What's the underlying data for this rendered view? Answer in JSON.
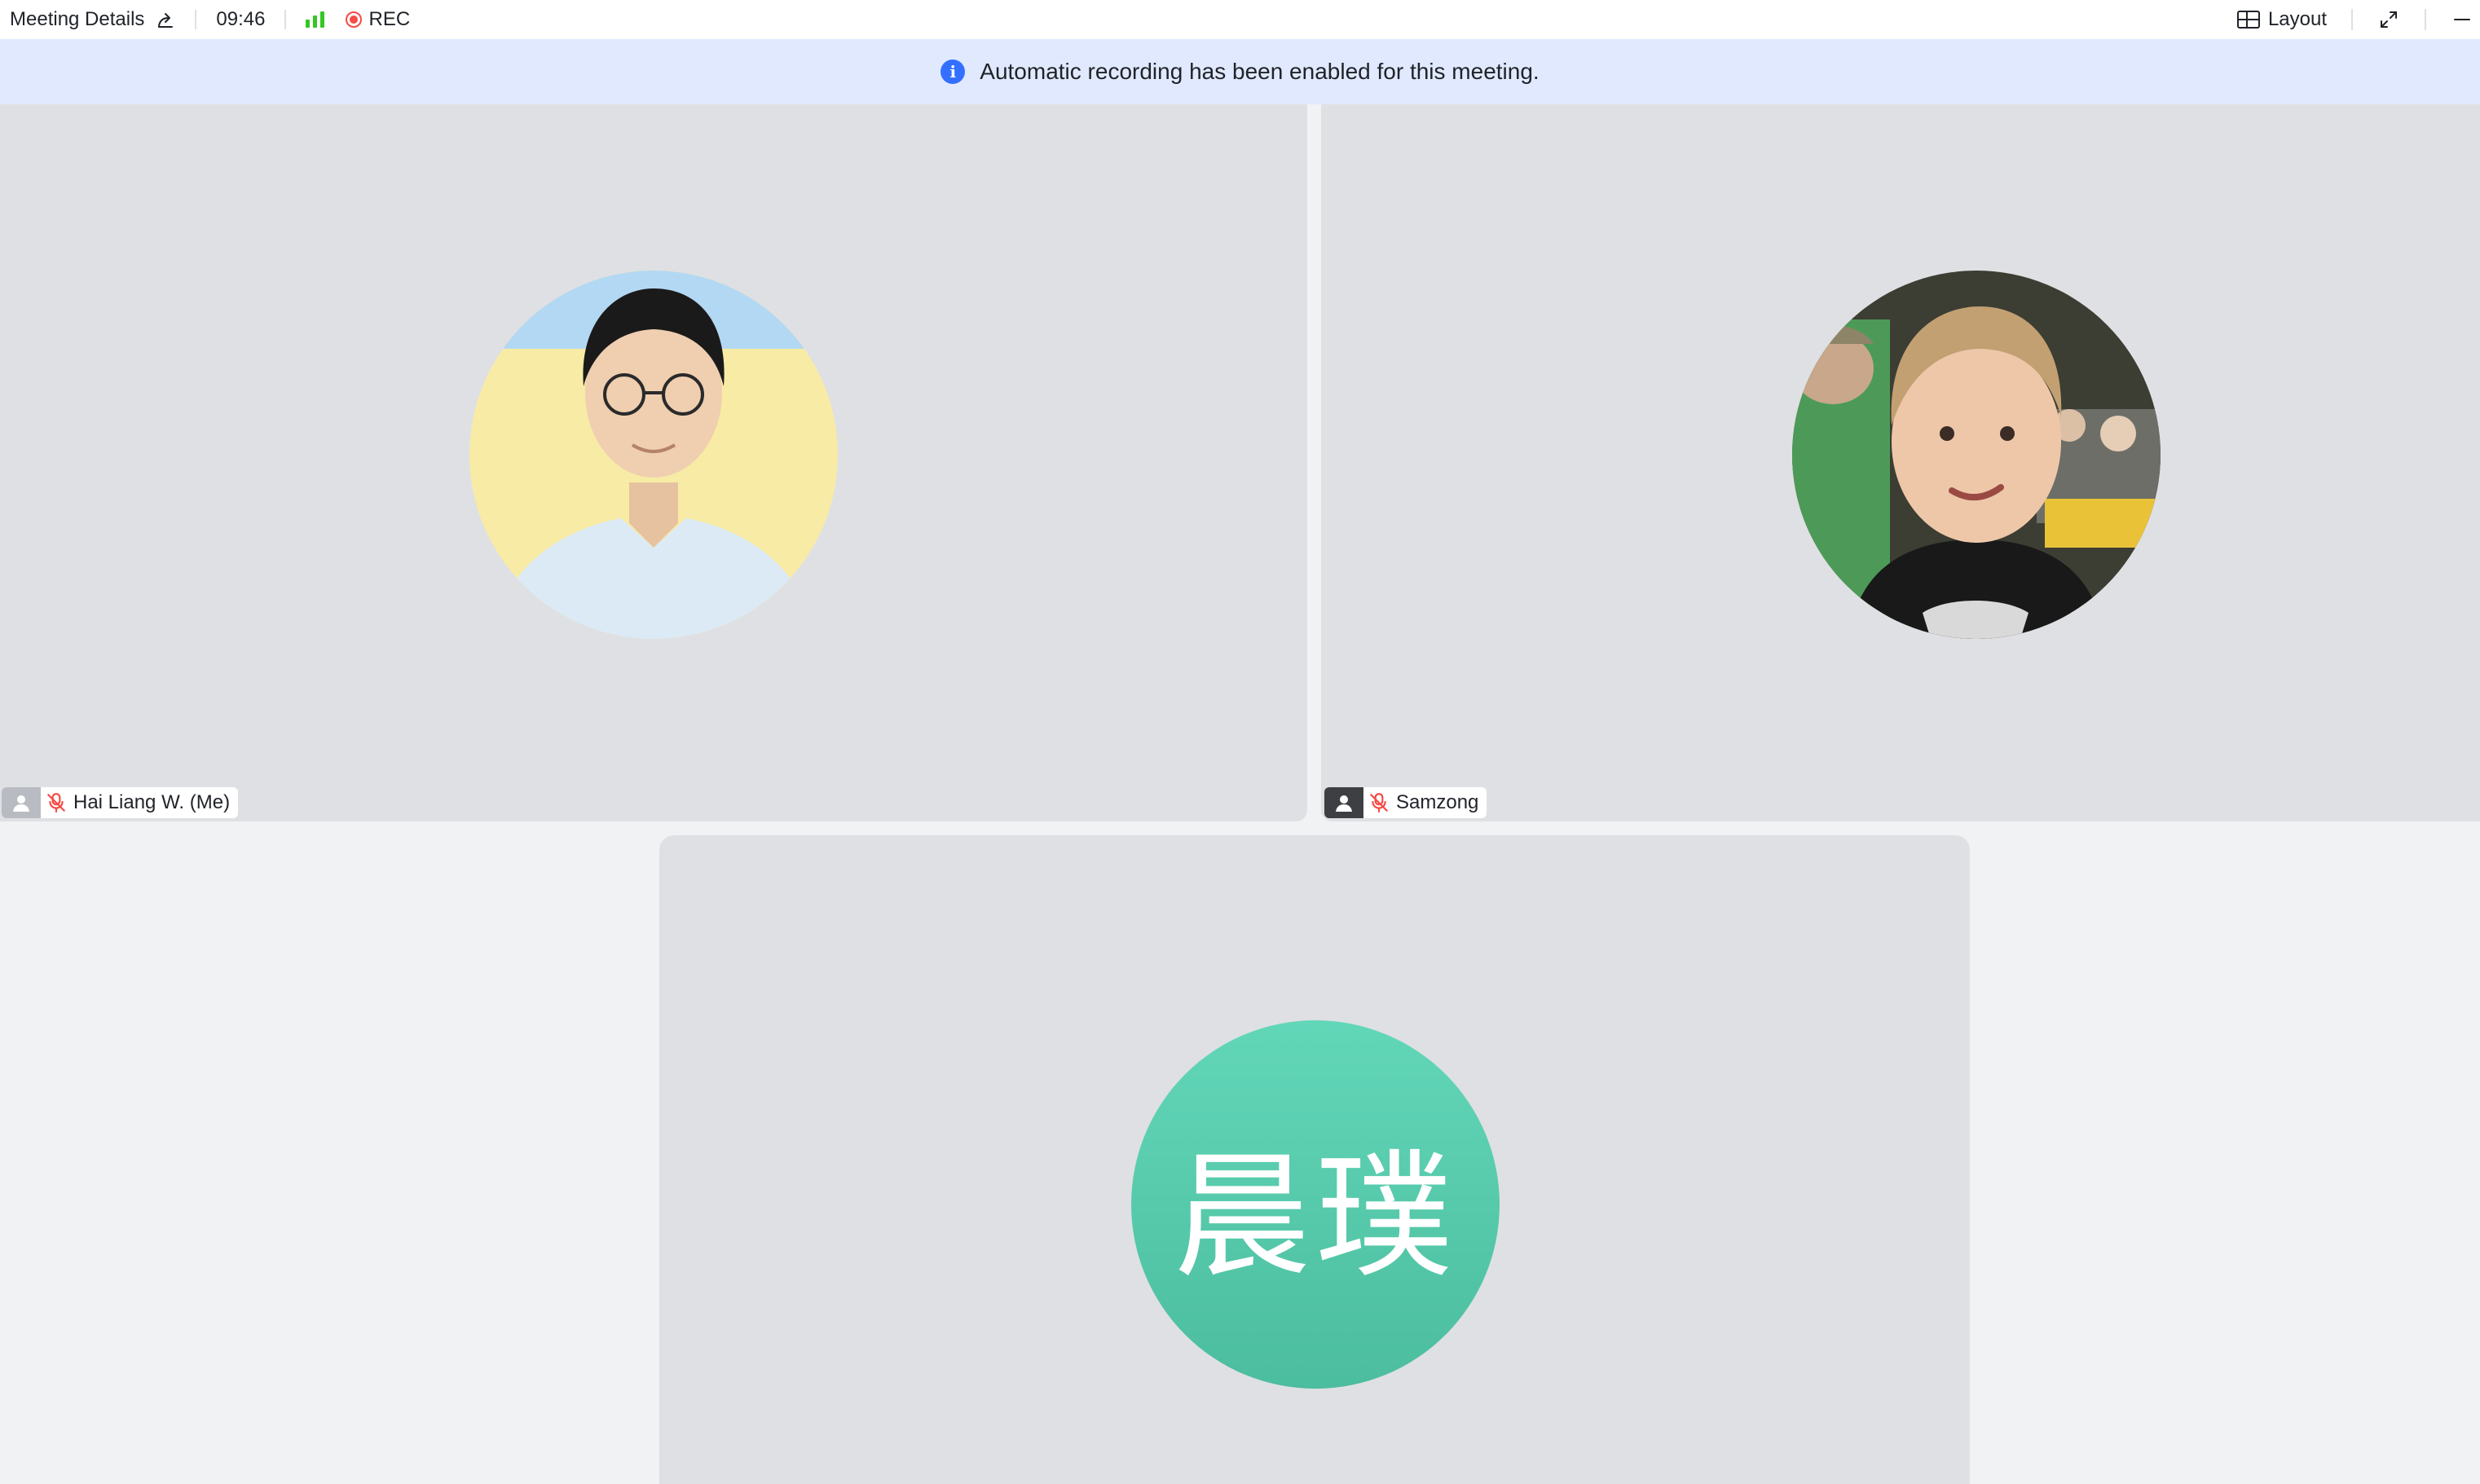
{
  "topbar": {
    "title": "Meeting Details",
    "time": "09:46",
    "rec_label": "REC",
    "layout_label": "Layout",
    "icons": [
      "share-icon",
      "signal-icon",
      "record-icon",
      "layout-icon",
      "expand-icon",
      "minimize-icon"
    ]
  },
  "banner": {
    "text": "Automatic recording has been enabled for this meeting.",
    "icon_glyph": "i"
  },
  "participants": [
    {
      "name": "Hai Liang W. (Me)",
      "muted": true,
      "avatar": "photo"
    },
    {
      "name": "Samzong",
      "muted": true,
      "avatar": "photo"
    },
    {
      "name": "",
      "avatar_text": "晨璞",
      "avatar_color": "#5ccbac"
    }
  ],
  "colors": {
    "accent": "#3370ff",
    "rec": "#f54a45",
    "signal": "#34c724",
    "banner_bg": "#e1e9fe",
    "tile_bg": "#dfe0e3"
  }
}
